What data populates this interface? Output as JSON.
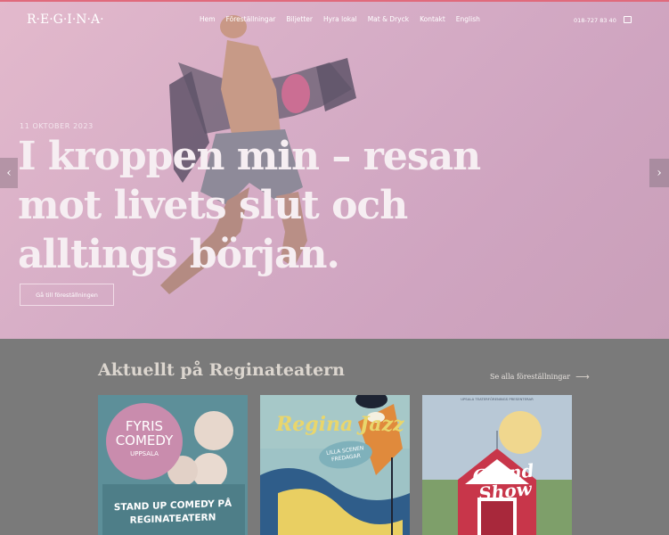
{
  "brand": {
    "logo_text": "R·E·G·I·N·A·"
  },
  "nav": {
    "items": [
      "Hem",
      "Föreställningar",
      "Biljetter",
      "Hyra lokal",
      "Mat & Dryck",
      "Kontakt",
      "English"
    ]
  },
  "header": {
    "phone": "018-727 83 40"
  },
  "hero": {
    "date": "11 OKTOBER 2023",
    "title": "I kroppen min – resan mot livets slut och alltings början.",
    "cta_label": "Gå till föreställningen",
    "prev_label": "‹",
    "next_label": "›"
  },
  "section": {
    "title": "Aktuellt på Reginateatern",
    "see_all_label": "Se alla föreställningar",
    "see_all_arrow": "⟶"
  },
  "cards": [
    {
      "circle_title": "FYRIS COMEDY",
      "circle_sub": "UPPSALA",
      "tagline": "STAND UP COMEDY PÅ REGINATEATERN"
    },
    {
      "title": "Regina Jazz",
      "badge": "LILLA SCENEN FREDAGAR"
    },
    {
      "top_text": "UPSALA TEATERFÖRENINGS PRESENTERAR",
      "title": "Grand Show"
    }
  ],
  "colors": {
    "accent_line": "#e06a7c",
    "hero_bg": "#dcb2c8",
    "section_bg": "#7a7a7a"
  }
}
